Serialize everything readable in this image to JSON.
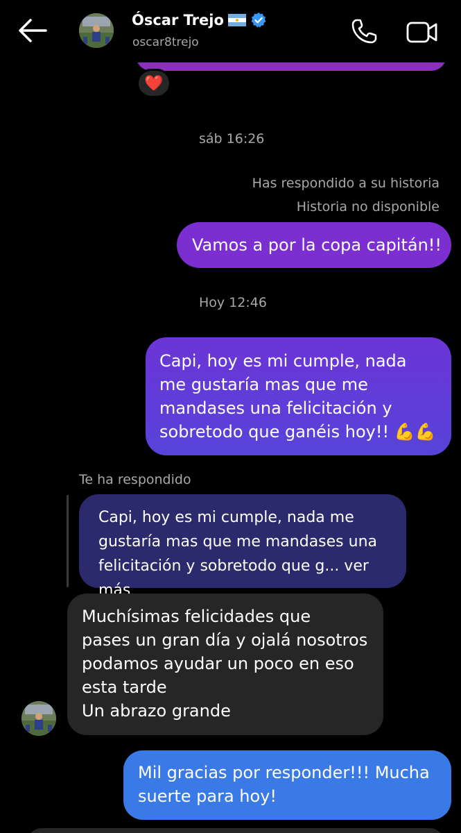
{
  "header": {
    "name": "Óscar Trejo",
    "flag": "🇦🇷",
    "username": "oscar8trejo",
    "back_icon": "arrow-left-icon",
    "call_icon": "phone-icon",
    "video_icon": "video-camera-icon",
    "verified_icon": "verified-badge-icon"
  },
  "reaction": "❤️",
  "timestamps": {
    "first": "sáb 16:26",
    "second": "Hoy 12:46"
  },
  "story_reply": {
    "label": "Has respondido a su historia",
    "status": "Historia no disponible"
  },
  "messages": {
    "m1": "Vamos a por la copa capitán!!",
    "m2_text": "Capi, hoy es mi cumple, nada me gustaría mas que me mandases una felicitación y sobretodo que ganéis hoy!!",
    "m2_emoji": "💪💪",
    "reply_label": "Te ha respondido",
    "quoted": "Capi, hoy es mi cumple, nada me gustaría mas que me mandases una felicitación y sobretodo que g... ver más",
    "m3_lines": [
      "Muchísimas felicidades que",
      "pases un gran día y ojalá nosotros",
      "podamos ayudar un poco en eso",
      "esta tarde",
      "Un abrazo grande"
    ],
    "m4": "Mil gracias por responder!!! Mucha suerte para hoy!"
  },
  "colors": {
    "background": "#000000",
    "sent_purple": "#7b2fd0",
    "sent_blue": "#3a7ae6",
    "received_gray": "#262626",
    "quoted_bg": "#2a2a6c",
    "verified_blue": "#3897f0"
  }
}
